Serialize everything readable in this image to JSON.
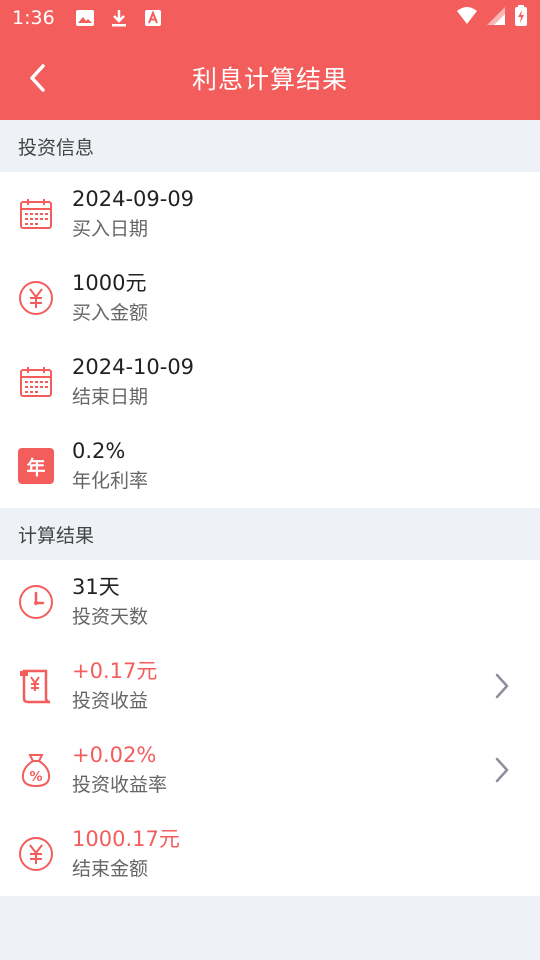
{
  "status_bar": {
    "time": "1:36",
    "icons": [
      "image-icon",
      "download-icon",
      "font-icon",
      "wifi-icon",
      "signal-icon",
      "battery-icon"
    ]
  },
  "app_bar": {
    "title": "利息计算结果",
    "back_icon": "chevron-left-icon"
  },
  "sections": {
    "investment": {
      "header": "投资信息",
      "rows": [
        {
          "value": "2024-09-09",
          "label": "买入日期",
          "icon": "calendar-icon"
        },
        {
          "value": "1000元",
          "label": "买入金额",
          "icon": "yen-circle-icon"
        },
        {
          "value": "2024-10-09",
          "label": "结束日期",
          "icon": "calendar-icon"
        },
        {
          "value": "0.2%",
          "label": "年化利率",
          "icon": "year-badge-icon",
          "badge_text": "年"
        }
      ]
    },
    "result": {
      "header": "计算结果",
      "rows": [
        {
          "value": "31天",
          "label": "投资天数",
          "icon": "clock-icon"
        },
        {
          "value": "+0.17元",
          "label": "投资收益",
          "icon": "scroll-yen-icon"
        },
        {
          "value": "+0.02%",
          "label": "投资收益率",
          "icon": "money-bag-icon"
        },
        {
          "value": "1000.17元",
          "label": "结束金额",
          "icon": "yen-circle-icon"
        }
      ]
    }
  },
  "colors": {
    "accent": "#f35d5b",
    "background": "#eef2f6",
    "text_primary": "#222222",
    "text_secondary": "#666666"
  }
}
